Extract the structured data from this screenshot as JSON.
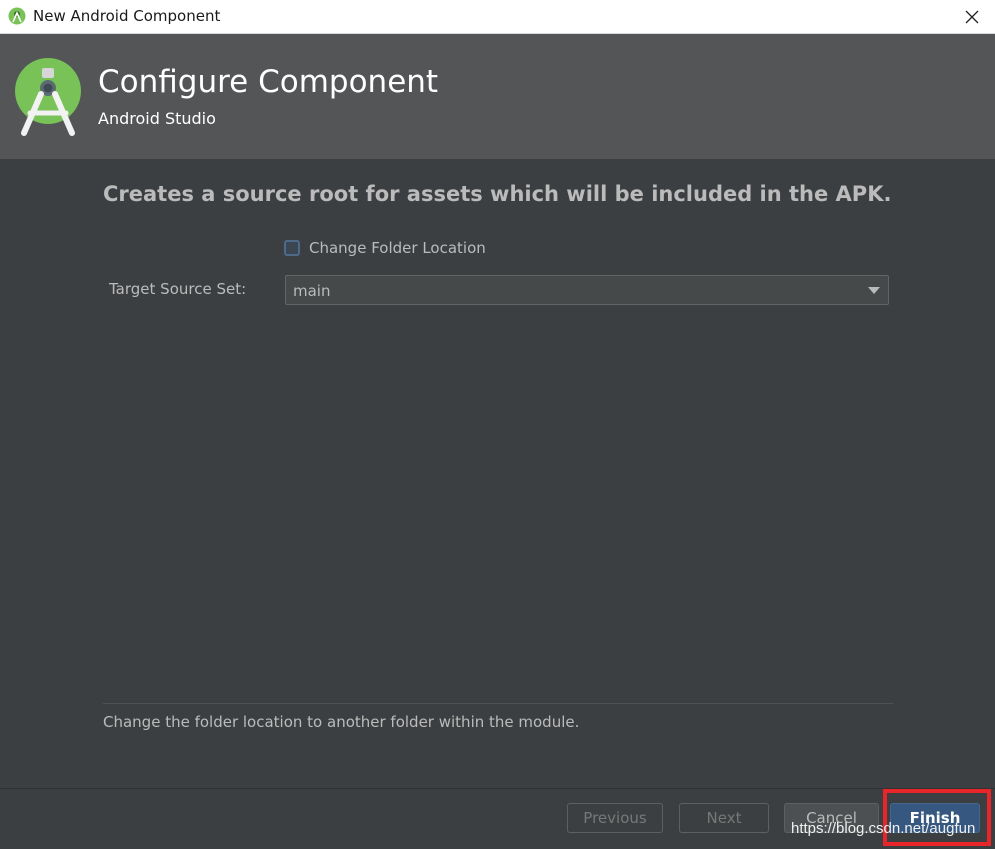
{
  "window": {
    "title": "New Android Component",
    "close_glyph": "✕"
  },
  "header": {
    "title": "Configure Component",
    "subtitle": "Android Studio",
    "logo_icon": "android-studio-logo-icon"
  },
  "main": {
    "description": "Creates a source root for assets which will be included in the APK.",
    "checkbox": {
      "label": "Change Folder Location",
      "checked": false
    },
    "target_source_set": {
      "label": "Target Source Set:",
      "value": "main"
    },
    "help_text": "Change the folder location to another folder within the module."
  },
  "footer": {
    "previous_label": "Previous",
    "next_label": "Next",
    "cancel_label": "Cancel",
    "finish_label": "Finish"
  },
  "watermark": "https://blog.csdn.net/augfun",
  "colors": {
    "background": "#3c3f41",
    "header": "#535557",
    "accent_button": "#365880",
    "highlight": "#e8262a"
  }
}
